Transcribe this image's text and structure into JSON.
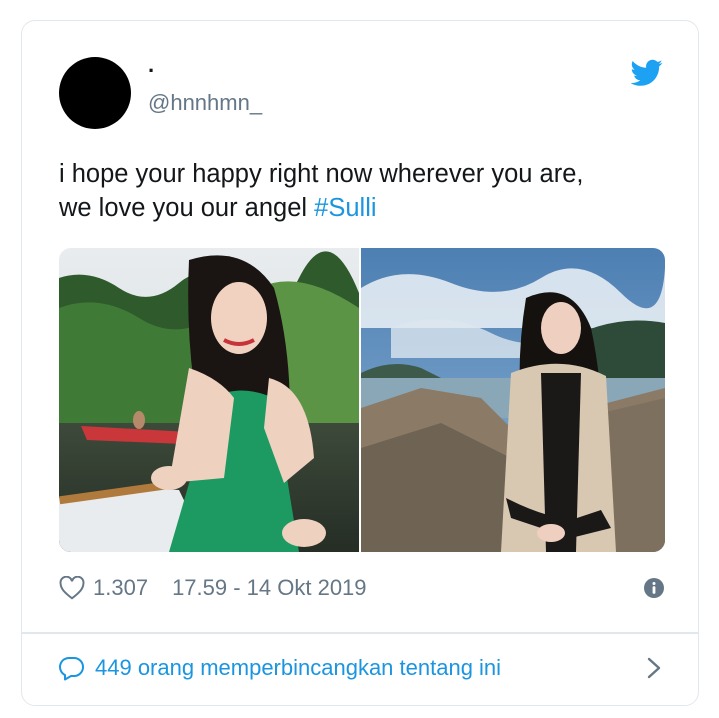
{
  "tweet": {
    "display_name": "·",
    "handle": "@hnnhmn_",
    "text_before": "i hope your happy right now wherever you are,\nwe love you our angel ",
    "hashtag": "#Sulli",
    "likes": "1.307",
    "timestamp": "17.59 - 14 Okt 2019",
    "discussion": "449 orang memperbincangkan tentang ini"
  },
  "icons": {
    "logo": "twitter-bird-icon",
    "like": "heart-icon",
    "info": "info-icon",
    "reply": "speech-bubble-icon",
    "more": "chevron-right-icon"
  },
  "colors": {
    "link": "#1b95e0",
    "muted": "#657786",
    "text": "#14171a",
    "border": "#e1e8ed"
  }
}
